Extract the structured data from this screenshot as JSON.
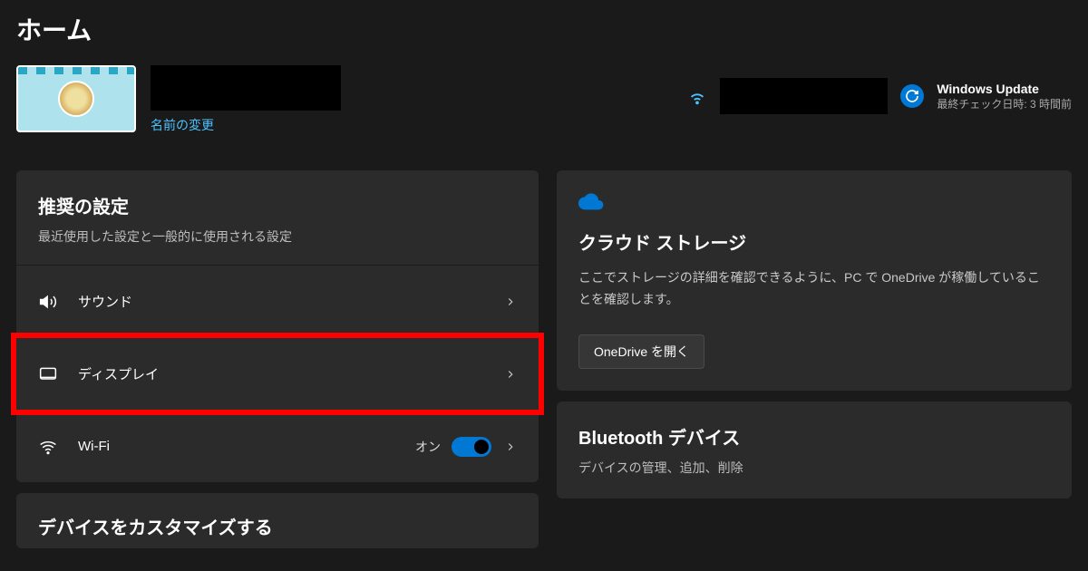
{
  "page_title": "ホーム",
  "account": {
    "rename_link": "名前の変更"
  },
  "windows_update": {
    "title": "Windows Update",
    "subtitle": "最終チェック日時: 3 時間前"
  },
  "recommended": {
    "title": "推奨の設定",
    "subtitle": "最近使用した設定と一般的に使用される設定",
    "items": [
      {
        "label": "サウンド"
      },
      {
        "label": "ディスプレイ"
      },
      {
        "label": "Wi-Fi",
        "status": "オン",
        "toggle": true
      }
    ]
  },
  "customize": {
    "title": "デバイスをカスタマイズする"
  },
  "cloud": {
    "title": "クラウド ストレージ",
    "description": "ここでストレージの詳細を確認できるように、PC で OneDrive が稼働していることを確認します。",
    "button": "OneDrive を開く"
  },
  "bluetooth": {
    "title": "Bluetooth デバイス",
    "subtitle": "デバイスの管理、追加、削除"
  }
}
